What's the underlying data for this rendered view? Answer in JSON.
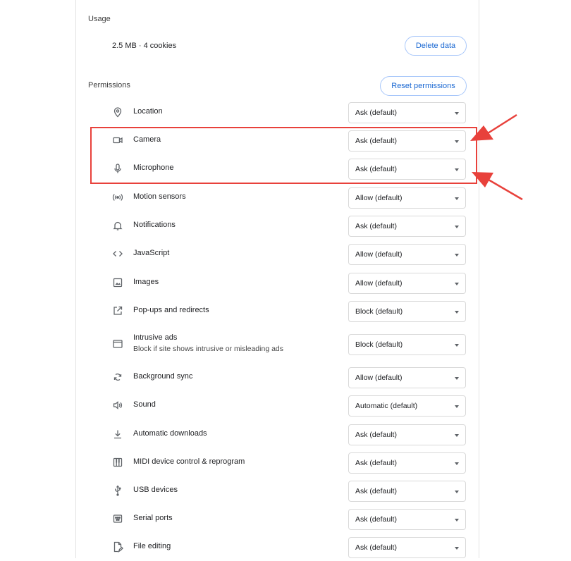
{
  "usage": {
    "title": "Usage",
    "summary": "2.5 MB · 4 cookies",
    "delete_label": "Delete data"
  },
  "permissions": {
    "title": "Permissions",
    "reset_label": "Reset permissions",
    "items": [
      {
        "label": "Location",
        "value": "Ask (default)",
        "icon": "location-pin-icon"
      },
      {
        "label": "Camera",
        "value": "Ask (default)",
        "icon": "camera-icon"
      },
      {
        "label": "Microphone",
        "value": "Ask (default)",
        "icon": "microphone-icon"
      },
      {
        "label": "Motion sensors",
        "value": "Allow (default)",
        "icon": "motion-sensors-icon"
      },
      {
        "label": "Notifications",
        "value": "Ask (default)",
        "icon": "bell-icon"
      },
      {
        "label": "JavaScript",
        "value": "Allow (default)",
        "icon": "code-icon"
      },
      {
        "label": "Images",
        "value": "Allow (default)",
        "icon": "image-icon"
      },
      {
        "label": "Pop-ups and redirects",
        "value": "Block (default)",
        "icon": "open-in-new-icon"
      },
      {
        "label": "Intrusive ads",
        "sublabel": "Block if site shows intrusive or misleading ads",
        "value": "Block (default)",
        "icon": "ads-icon"
      },
      {
        "label": "Background sync",
        "value": "Allow (default)",
        "icon": "sync-icon"
      },
      {
        "label": "Sound",
        "value": "Automatic (default)",
        "icon": "speaker-icon"
      },
      {
        "label": "Automatic downloads",
        "value": "Ask (default)",
        "icon": "download-icon"
      },
      {
        "label": "MIDI device control & reprogram",
        "value": "Ask (default)",
        "icon": "piano-icon"
      },
      {
        "label": "USB devices",
        "value": "Ask (default)",
        "icon": "usb-icon"
      },
      {
        "label": "Serial ports",
        "value": "Ask (default)",
        "icon": "serial-port-icon"
      },
      {
        "label": "File editing",
        "value": "Ask (default)",
        "icon": "file-edit-icon"
      }
    ]
  },
  "annotation": {
    "color": "#e8413b"
  }
}
